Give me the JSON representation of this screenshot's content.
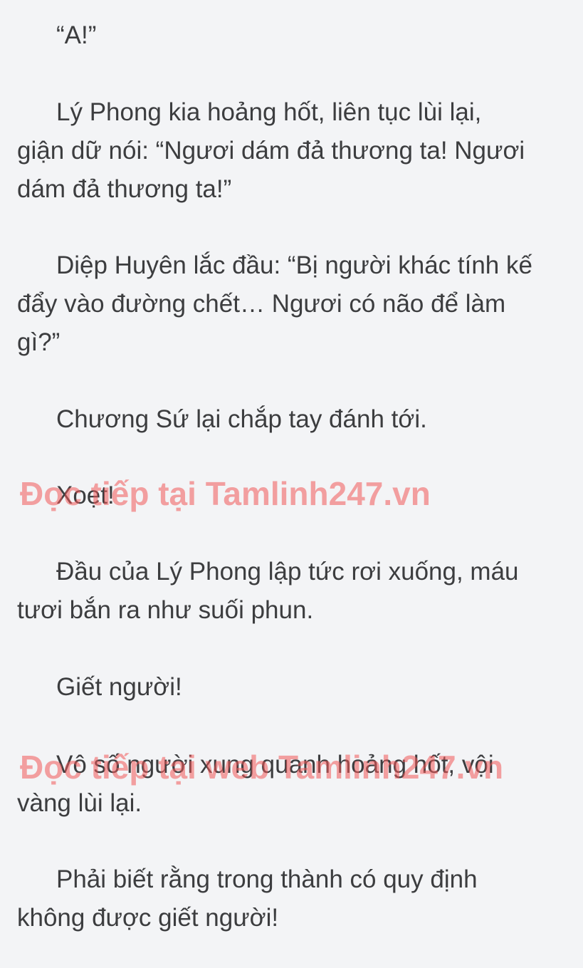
{
  "chapter": {
    "lines": [
      "“A!”",
      "Lý Phong kia hoảng hốt, liên tục lùi lại,",
      "giận dữ nói: “Ngươi dám đả thương ta! Ngươi",
      "dám đả thương ta!”",
      "Diệp Huyên lắc đầu: “Bị người khác tính kế",
      "đẩy vào đường chết… Ngươi có não để làm",
      "gì?”",
      "Chương Sứ lại chắp tay đánh tới.",
      "Xoẹt!",
      "Đầu của Lý Phong lập tức rơi xuống, máu",
      "tươi bắn ra như suối phun.",
      "Giết người!",
      "Vô số người xung quanh hoảng hốt, vội",
      "vàng lùi lại.",
      "Phải biết rằng trong thành có quy định",
      "không được giết người!"
    ]
  },
  "watermarks": {
    "first": "Đọc tiếp tại Tamlinh247.vn",
    "second": "Đọc tiếp tại web Tamlinh247.vn"
  },
  "colors": {
    "background": "#f3f4f6",
    "text": "#3c3d3f",
    "watermark": "#f05858"
  }
}
